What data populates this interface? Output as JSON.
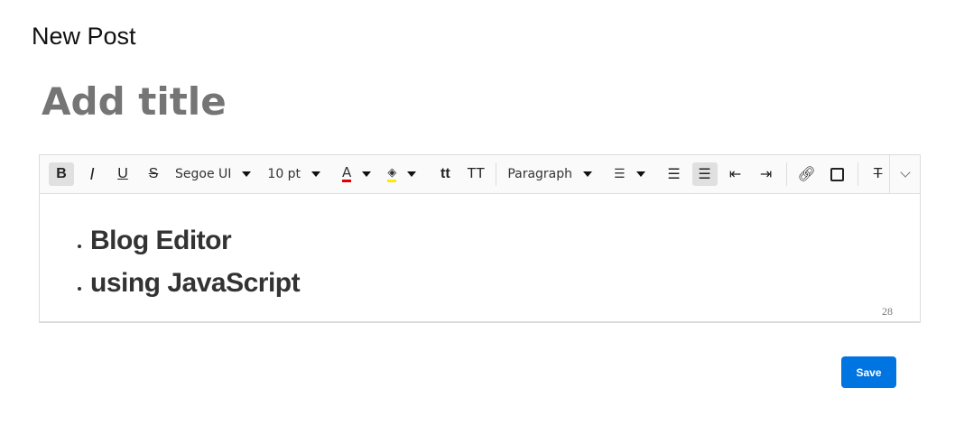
{
  "page": {
    "title": "New Post"
  },
  "title_input": {
    "placeholder": "Add title"
  },
  "toolbar": {
    "bold": "B",
    "italic": "I",
    "underline": "U",
    "strike": "S",
    "font_name": "Segoe UI",
    "font_size": "10 pt",
    "font_color_label": "A",
    "font_color": "#e00000",
    "bg_color": "#ffea00",
    "format": "Paragraph"
  },
  "content": {
    "items": [
      "Blog Editor",
      "using JavaScript"
    ]
  },
  "char_count": "28",
  "save_label": "Save",
  "colors": {
    "accent": "#0074e0"
  }
}
